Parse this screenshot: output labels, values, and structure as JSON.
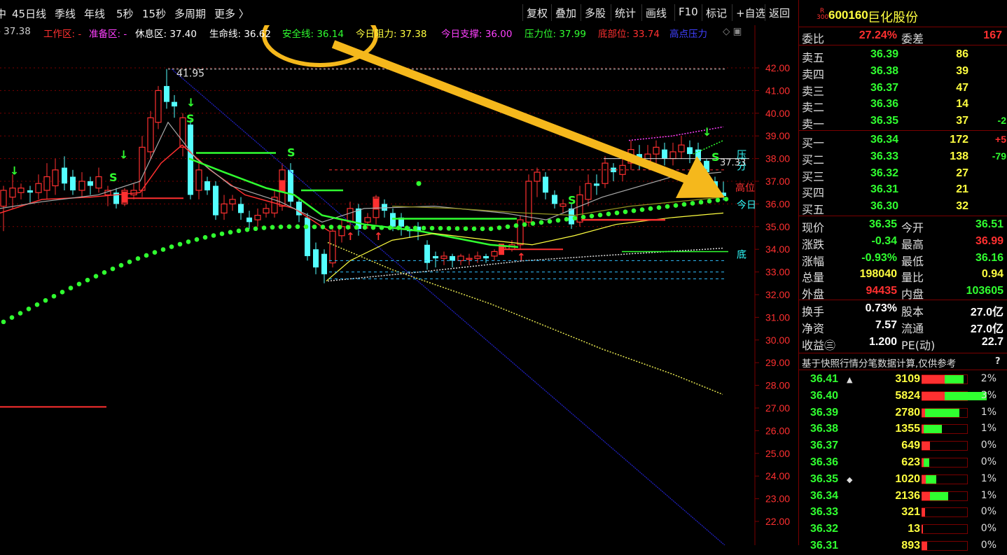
{
  "toolbar": {
    "left_items": [
      "中",
      "45日线",
      "季线",
      "年线",
      "5秒",
      "15秒",
      "多周期",
      "更多 〉"
    ],
    "right_items": [
      "复权",
      "叠加",
      "多股",
      "统计",
      "画线",
      "F10",
      "标记",
      "+自选",
      "返回"
    ]
  },
  "indicator_bar": [
    {
      "text": "- 37.38",
      "color": "#cccccc"
    },
    {
      "text": "工作区: -",
      "color": "#ff3030"
    },
    {
      "text": "准备区: -",
      "color": "#ff40ff"
    },
    {
      "text": "休息区: 37.40",
      "color": "#ffffff"
    },
    {
      "text": "生命线: 36.62",
      "color": "#ffffff"
    },
    {
      "text": "安全线: 36.14",
      "color": "#30ff30"
    },
    {
      "text": "今日阻力: 37.38",
      "color": "#ffff40"
    },
    {
      "text": "今日支撑: 36.00",
      "color": "#ff40ff"
    },
    {
      "text": "压力位: 37.99",
      "color": "#30ff30"
    },
    {
      "text": "底部位: 33.74",
      "color": "#ff3030"
    },
    {
      "text": "高点压力",
      "color": "#4040ff"
    }
  ],
  "chart_data": {
    "type": "candlestick",
    "y_axis_ticks": [
      "42.00",
      "41.00",
      "40.00",
      "39.00",
      "38.00",
      "37.00",
      "36.00",
      "35.00",
      "34.00",
      "33.00",
      "32.00",
      "31.00",
      "30.00",
      "29.00",
      "28.00",
      "27.00",
      "26.00",
      "25.00",
      "24.00",
      "23.00",
      "22.00"
    ],
    "high_label": "41.95",
    "right_markers": [
      "压",
      "分",
      "高位",
      "今日",
      "底"
    ],
    "price_readout": "37.33"
  },
  "stock": {
    "badge_top": "R",
    "badge_bottom": "300",
    "code": "600160",
    "name": "巨化股份"
  },
  "weibi": {
    "label1": "委比",
    "value1": "27.24%",
    "label2": "委差",
    "value2": "167"
  },
  "asks": [
    {
      "label": "卖五",
      "price": "36.39",
      "vol": "86",
      "chg": ""
    },
    {
      "label": "卖四",
      "price": "36.38",
      "vol": "39",
      "chg": ""
    },
    {
      "label": "卖三",
      "price": "36.37",
      "vol": "47",
      "chg": ""
    },
    {
      "label": "卖二",
      "price": "36.36",
      "vol": "14",
      "chg": ""
    },
    {
      "label": "卖一",
      "price": "36.35",
      "vol": "37",
      "chg": "-2"
    }
  ],
  "bids": [
    {
      "label": "买一",
      "price": "36.34",
      "vol": "172",
      "chg": "+5"
    },
    {
      "label": "买二",
      "price": "36.33",
      "vol": "138",
      "chg": "-79"
    },
    {
      "label": "买三",
      "price": "36.32",
      "vol": "27",
      "chg": ""
    },
    {
      "label": "买四",
      "price": "36.31",
      "vol": "21",
      "chg": ""
    },
    {
      "label": "买五",
      "price": "36.30",
      "vol": "32",
      "chg": ""
    }
  ],
  "quote": [
    {
      "l1": "现价",
      "v1": "36.35",
      "c1": "#30ff30",
      "l2": "今开",
      "v2": "36.51",
      "c2": "#30ff30"
    },
    {
      "l1": "涨跌",
      "v1": "-0.34",
      "c1": "#30ff30",
      "l2": "最高",
      "v2": "36.99",
      "c2": "#ff3030"
    },
    {
      "l1": "涨幅",
      "v1": "-0.93%",
      "c1": "#30ff30",
      "l2": "最低",
      "v2": "36.16",
      "c2": "#30ff30"
    },
    {
      "l1": "总量",
      "v1": "198040",
      "c1": "#ffff40",
      "l2": "量比",
      "v2": "0.94",
      "c2": "#ffff40"
    },
    {
      "l1": "外盘",
      "v1": "94435",
      "c1": "#ff3030",
      "l2": "内盘",
      "v2": "103605",
      "c2": "#30ff30"
    }
  ],
  "fundamentals": [
    {
      "l1": "换手",
      "v1": "0.73%",
      "l2": "股本",
      "v2": "27.0亿"
    },
    {
      "l1": "净资",
      "v1": "7.57",
      "l2": "流通",
      "v2": "27.0亿"
    },
    {
      "l1": "收益㊂",
      "v1": "1.200",
      "l2": "PE(动)",
      "v2": "22.7"
    }
  ],
  "dist_note": "基于快照行情分笔数据计算,仅供参考",
  "dist_help": "?",
  "distribution": [
    {
      "price": "36.41",
      "mark": "▲",
      "vol": "3109",
      "pct": "2%",
      "red": 0.22,
      "green": 0.18
    },
    {
      "price": "36.40",
      "mark": "",
      "vol": "5824",
      "pct": "3%",
      "red": 0.22,
      "green": 0.4
    },
    {
      "price": "36.39",
      "mark": "",
      "vol": "2780",
      "pct": "1%",
      "red": 0.03,
      "green": 0.33
    },
    {
      "price": "36.38",
      "mark": "",
      "vol": "1355",
      "pct": "1%",
      "red": 0.02,
      "green": 0.17
    },
    {
      "price": "36.37",
      "mark": "",
      "vol": "649",
      "pct": "0%",
      "red": 0.08,
      "green": 0.0
    },
    {
      "price": "36.36",
      "mark": "",
      "vol": "623",
      "pct": "0%",
      "red": 0.02,
      "green": 0.05
    },
    {
      "price": "36.35",
      "mark": "◆",
      "vol": "1020",
      "pct": "1%",
      "red": 0.04,
      "green": 0.1
    },
    {
      "price": "36.34",
      "mark": "",
      "vol": "2136",
      "pct": "1%",
      "red": 0.08,
      "green": 0.17
    },
    {
      "price": "36.33",
      "mark": "",
      "vol": "321",
      "pct": "0%",
      "red": 0.03,
      "green": 0.0
    },
    {
      "price": "36.32",
      "mark": "",
      "vol": "13",
      "pct": "0%",
      "red": 0.01,
      "green": 0.0
    },
    {
      "price": "36.31",
      "mark": "",
      "vol": "893",
      "pct": "0%",
      "red": 0.05,
      "green": 0.0
    }
  ],
  "colors": {
    "up": "#ff3030",
    "down": "#54ffff",
    "accent": "#f5b81c",
    "grid": "#7a0000"
  }
}
